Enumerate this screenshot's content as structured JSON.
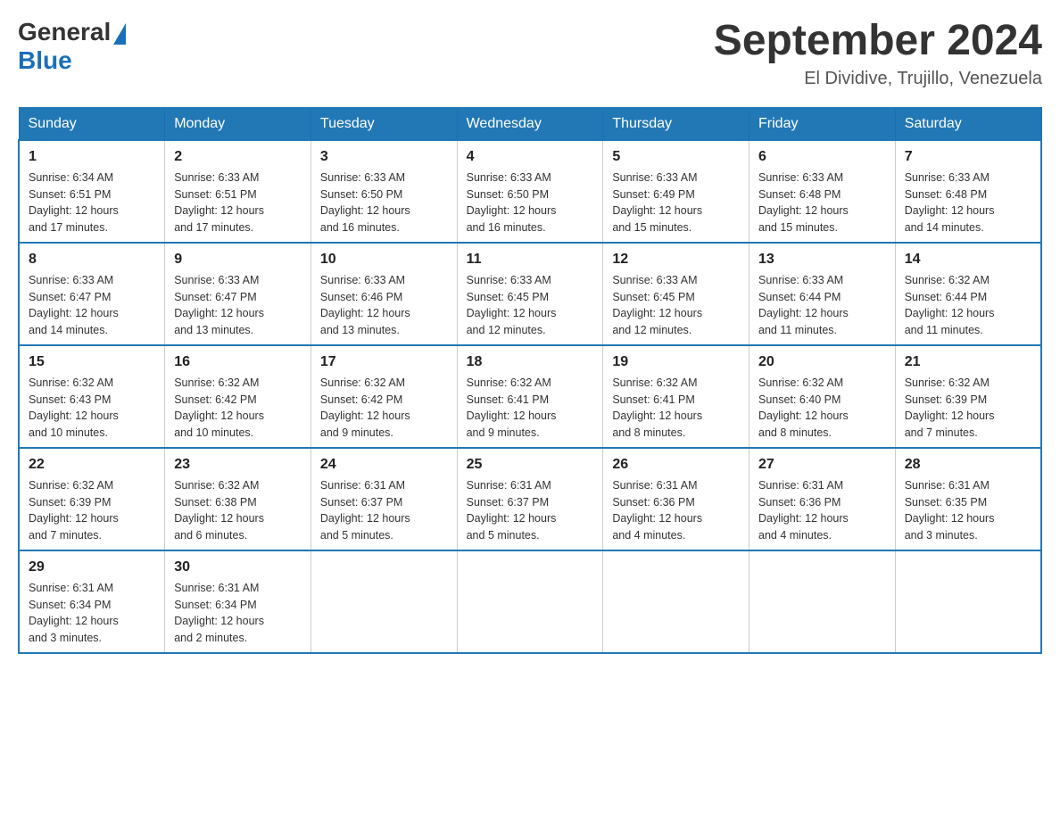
{
  "header": {
    "logo_general": "General",
    "logo_blue": "Blue",
    "month_title": "September 2024",
    "location": "El Dividive, Trujillo, Venezuela"
  },
  "days_of_week": [
    "Sunday",
    "Monday",
    "Tuesday",
    "Wednesday",
    "Thursday",
    "Friday",
    "Saturday"
  ],
  "weeks": [
    [
      {
        "day": "1",
        "sunrise": "6:34 AM",
        "sunset": "6:51 PM",
        "daylight": "12 hours and 17 minutes."
      },
      {
        "day": "2",
        "sunrise": "6:33 AM",
        "sunset": "6:51 PM",
        "daylight": "12 hours and 17 minutes."
      },
      {
        "day": "3",
        "sunrise": "6:33 AM",
        "sunset": "6:50 PM",
        "daylight": "12 hours and 16 minutes."
      },
      {
        "day": "4",
        "sunrise": "6:33 AM",
        "sunset": "6:50 PM",
        "daylight": "12 hours and 16 minutes."
      },
      {
        "day": "5",
        "sunrise": "6:33 AM",
        "sunset": "6:49 PM",
        "daylight": "12 hours and 15 minutes."
      },
      {
        "day": "6",
        "sunrise": "6:33 AM",
        "sunset": "6:48 PM",
        "daylight": "12 hours and 15 minutes."
      },
      {
        "day": "7",
        "sunrise": "6:33 AM",
        "sunset": "6:48 PM",
        "daylight": "12 hours and 14 minutes."
      }
    ],
    [
      {
        "day": "8",
        "sunrise": "6:33 AM",
        "sunset": "6:47 PM",
        "daylight": "12 hours and 14 minutes."
      },
      {
        "day": "9",
        "sunrise": "6:33 AM",
        "sunset": "6:47 PM",
        "daylight": "12 hours and 13 minutes."
      },
      {
        "day": "10",
        "sunrise": "6:33 AM",
        "sunset": "6:46 PM",
        "daylight": "12 hours and 13 minutes."
      },
      {
        "day": "11",
        "sunrise": "6:33 AM",
        "sunset": "6:45 PM",
        "daylight": "12 hours and 12 minutes."
      },
      {
        "day": "12",
        "sunrise": "6:33 AM",
        "sunset": "6:45 PM",
        "daylight": "12 hours and 12 minutes."
      },
      {
        "day": "13",
        "sunrise": "6:33 AM",
        "sunset": "6:44 PM",
        "daylight": "12 hours and 11 minutes."
      },
      {
        "day": "14",
        "sunrise": "6:32 AM",
        "sunset": "6:44 PM",
        "daylight": "12 hours and 11 minutes."
      }
    ],
    [
      {
        "day": "15",
        "sunrise": "6:32 AM",
        "sunset": "6:43 PM",
        "daylight": "12 hours and 10 minutes."
      },
      {
        "day": "16",
        "sunrise": "6:32 AM",
        "sunset": "6:42 PM",
        "daylight": "12 hours and 10 minutes."
      },
      {
        "day": "17",
        "sunrise": "6:32 AM",
        "sunset": "6:42 PM",
        "daylight": "12 hours and 9 minutes."
      },
      {
        "day": "18",
        "sunrise": "6:32 AM",
        "sunset": "6:41 PM",
        "daylight": "12 hours and 9 minutes."
      },
      {
        "day": "19",
        "sunrise": "6:32 AM",
        "sunset": "6:41 PM",
        "daylight": "12 hours and 8 minutes."
      },
      {
        "day": "20",
        "sunrise": "6:32 AM",
        "sunset": "6:40 PM",
        "daylight": "12 hours and 8 minutes."
      },
      {
        "day": "21",
        "sunrise": "6:32 AM",
        "sunset": "6:39 PM",
        "daylight": "12 hours and 7 minutes."
      }
    ],
    [
      {
        "day": "22",
        "sunrise": "6:32 AM",
        "sunset": "6:39 PM",
        "daylight": "12 hours and 7 minutes."
      },
      {
        "day": "23",
        "sunrise": "6:32 AM",
        "sunset": "6:38 PM",
        "daylight": "12 hours and 6 minutes."
      },
      {
        "day": "24",
        "sunrise": "6:31 AM",
        "sunset": "6:37 PM",
        "daylight": "12 hours and 5 minutes."
      },
      {
        "day": "25",
        "sunrise": "6:31 AM",
        "sunset": "6:37 PM",
        "daylight": "12 hours and 5 minutes."
      },
      {
        "day": "26",
        "sunrise": "6:31 AM",
        "sunset": "6:36 PM",
        "daylight": "12 hours and 4 minutes."
      },
      {
        "day": "27",
        "sunrise": "6:31 AM",
        "sunset": "6:36 PM",
        "daylight": "12 hours and 4 minutes."
      },
      {
        "day": "28",
        "sunrise": "6:31 AM",
        "sunset": "6:35 PM",
        "daylight": "12 hours and 3 minutes."
      }
    ],
    [
      {
        "day": "29",
        "sunrise": "6:31 AM",
        "sunset": "6:34 PM",
        "daylight": "12 hours and 3 minutes."
      },
      {
        "day": "30",
        "sunrise": "6:31 AM",
        "sunset": "6:34 PM",
        "daylight": "12 hours and 2 minutes."
      },
      null,
      null,
      null,
      null,
      null
    ]
  ],
  "labels": {
    "sunrise_prefix": "Sunrise: ",
    "sunset_prefix": "Sunset: ",
    "daylight_prefix": "Daylight: "
  }
}
